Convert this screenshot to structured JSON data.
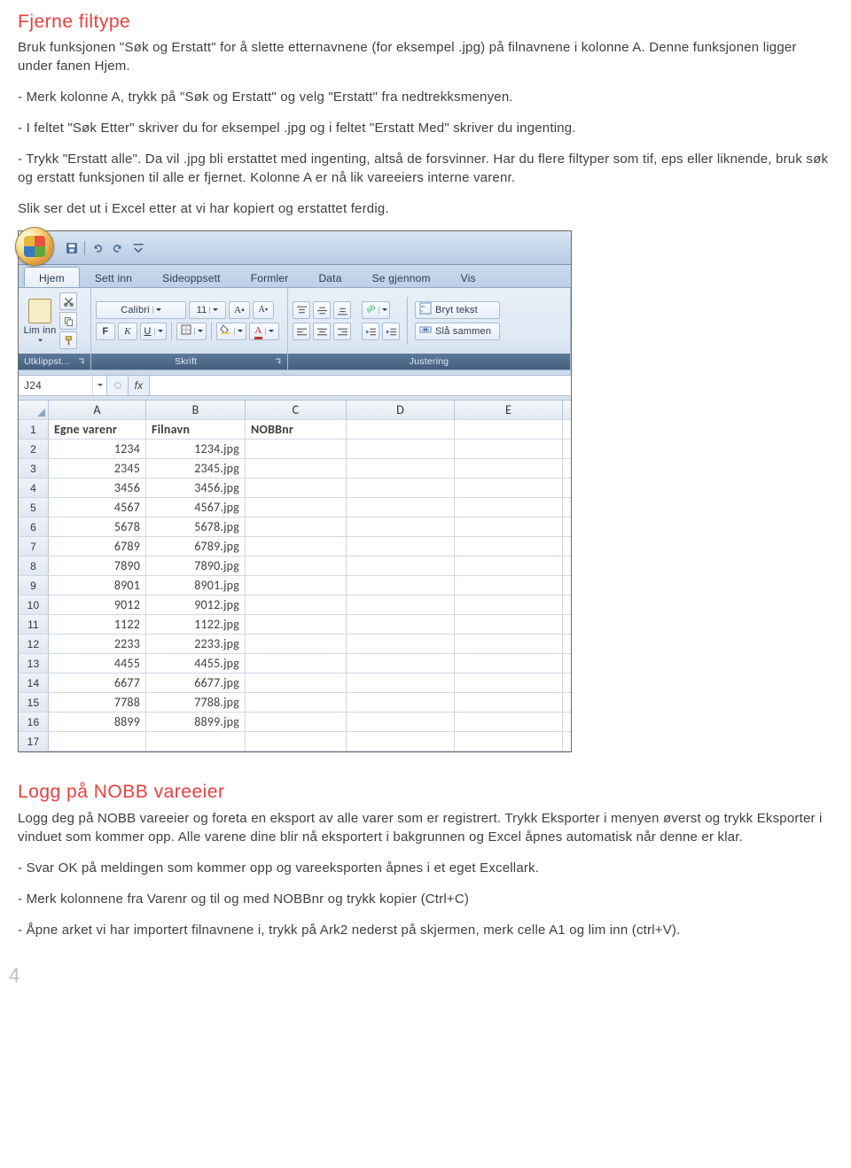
{
  "section1": {
    "title": "Fjerne filtype",
    "p1": "Bruk funksjonen \"Søk og Erstatt\" for å slette etternavnene (for eksempel .jpg) på filnavnene i kolonne A. Denne funksjonen ligger under fanen Hjem.",
    "p2": "- Merk kolonne A, trykk på \"Søk og Erstatt\" og velg \"Erstatt\" fra nedtrekksmenyen.",
    "p3": "- I feltet \"Søk Etter\" skriver du for eksempel .jpg og i feltet \"Erstatt Med\" skriver du ingenting.",
    "p4": "- Trykk \"Erstatt alle\". Da vil .jpg bli erstattet med ingenting, altså de forsvinner. Har du flere filtyper som tif, eps eller liknende, bruk søk og erstatt funksjonen til alle er fjernet. Kolonne A er nå lik vareeiers interne varenr.",
    "p5": "Slik ser det ut i Excel etter at vi har kopiert og erstattet ferdig."
  },
  "excel": {
    "tabs": [
      "Hjem",
      "Sett inn",
      "Sideoppsett",
      "Formler",
      "Data",
      "Se gjennom",
      "Vis"
    ],
    "clipboard": {
      "paste": "Lim inn",
      "label": "Utklippst..."
    },
    "font": {
      "name": "Calibri",
      "size": "11",
      "bold": "F",
      "italic": "K",
      "underline": "U",
      "label": "Skrift"
    },
    "alignment": {
      "wrap": "Bryt tekst",
      "merge": "Slå sammen",
      "label": "Justering"
    },
    "namebox": "J24",
    "fx": "fx",
    "columns": [
      "A",
      "B",
      "C",
      "D",
      "E"
    ],
    "headers": {
      "a": "Egne varenr",
      "b": "Filnavn",
      "c": "NOBBnr"
    },
    "rows": [
      {
        "n": "2",
        "a": "1234",
        "b": "1234.jpg"
      },
      {
        "n": "3",
        "a": "2345",
        "b": "2345.jpg"
      },
      {
        "n": "4",
        "a": "3456",
        "b": "3456.jpg"
      },
      {
        "n": "5",
        "a": "4567",
        "b": "4567.jpg"
      },
      {
        "n": "6",
        "a": "5678",
        "b": "5678.jpg"
      },
      {
        "n": "7",
        "a": "6789",
        "b": "6789.jpg"
      },
      {
        "n": "8",
        "a": "7890",
        "b": "7890.jpg"
      },
      {
        "n": "9",
        "a": "8901",
        "b": "8901.jpg"
      },
      {
        "n": "10",
        "a": "9012",
        "b": "9012.jpg"
      },
      {
        "n": "11",
        "a": "1122",
        "b": "1122.jpg"
      },
      {
        "n": "12",
        "a": "2233",
        "b": "2233.jpg"
      },
      {
        "n": "13",
        "a": "4455",
        "b": "4455.jpg"
      },
      {
        "n": "14",
        "a": "6677",
        "b": "6677.jpg"
      },
      {
        "n": "15",
        "a": "7788",
        "b": "7788.jpg"
      },
      {
        "n": "16",
        "a": "8899",
        "b": "8899.jpg"
      },
      {
        "n": "17",
        "a": "",
        "b": ""
      }
    ]
  },
  "section2": {
    "title": "Logg på NOBB vareeier",
    "p1": "Logg deg på NOBB vareeier og foreta en eksport av alle varer som er registrert. Trykk Eksporter i menyen øverst og trykk Eksporter i vinduet som kommer opp. Alle varene dine blir nå eksportert i bakgrunnen og Excel åpnes automatisk når denne er klar.",
    "p2": "- Svar OK på meldingen som kommer opp og vareeksporten åpnes i et eget Excellark.",
    "p3": "- Merk kolonnene fra Varenr og til og med NOBBnr og trykk kopier (Ctrl+C)",
    "p4": "- Åpne arket vi har importert filnavnene i, trykk på Ark2 nederst på skjermen, merk celle A1 og lim inn (ctrl+V)."
  },
  "pagenum": "4"
}
